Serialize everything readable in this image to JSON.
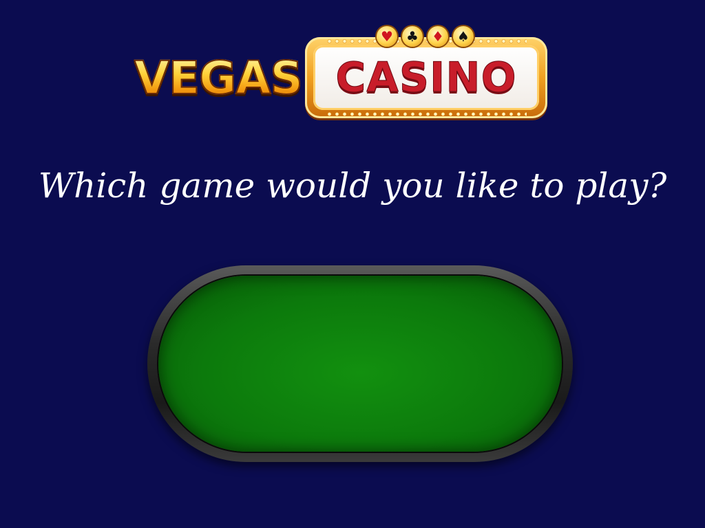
{
  "logo": {
    "vegas_text": "VEGAS",
    "casino_text": "CASINO",
    "suits": [
      {
        "name": "heart",
        "glyph": "♥",
        "color": "red"
      },
      {
        "name": "club",
        "glyph": "♣",
        "color": "black"
      },
      {
        "name": "diamond",
        "glyph": "♦",
        "color": "red"
      },
      {
        "name": "spade",
        "glyph": "♠",
        "color": "black"
      }
    ]
  },
  "prompt": {
    "question": "Which game would you like to play?"
  },
  "table": {
    "felt_color": "#0c7a0c",
    "rail_color": "#2a2a2a"
  },
  "theme": {
    "background": "#0b0c50",
    "casino_red": "#c81d2a",
    "vegas_gold": "#ffd23a"
  }
}
